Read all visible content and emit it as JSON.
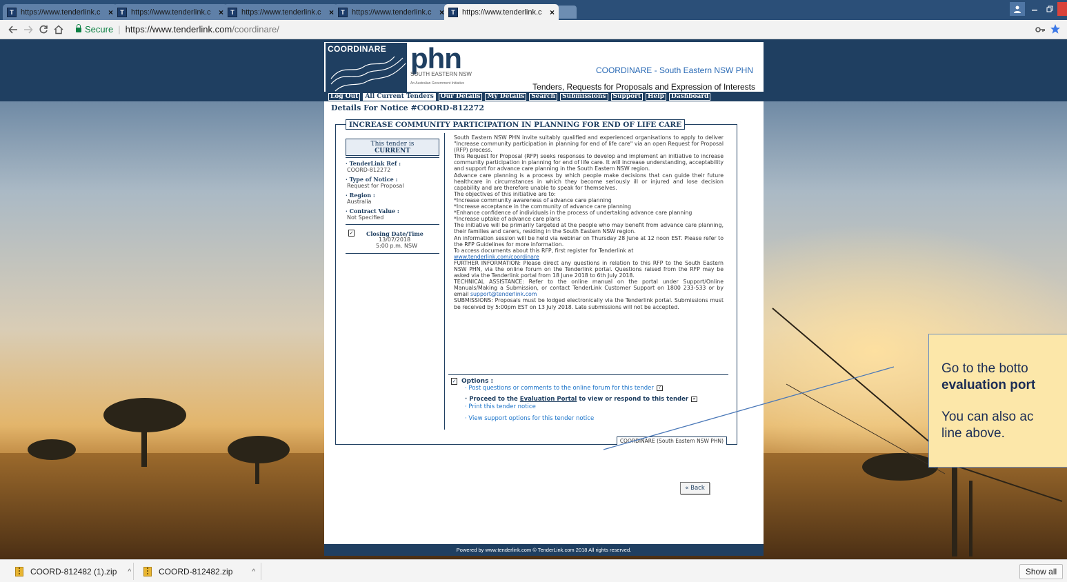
{
  "browser": {
    "tabs": [
      {
        "title": "https://www.tenderlink.c",
        "active": false
      },
      {
        "title": "https://www.tenderlink.c",
        "active": false
      },
      {
        "title": "https://www.tenderlink.c",
        "active": false
      },
      {
        "title": "https://www.tenderlink.c",
        "active": false
      },
      {
        "title": "https://www.tenderlink.c",
        "active": true
      }
    ],
    "favicon_text": "T",
    "tab_close": "×",
    "secure_label": "Secure",
    "url_main": "https://www.tenderlink.com",
    "url_path": "/coordinare/",
    "icons": [
      "back-arrow-icon",
      "forward-arrow-icon",
      "reload-icon",
      "home-icon",
      "lock-icon",
      "key-icon",
      "bookmark-star-icon"
    ],
    "accent": "#2b4f78"
  },
  "header": {
    "logo_word": "COORDINARE",
    "phn": "phn",
    "phn_sub": "SOUTH EASTERN NSW",
    "phn_gov": "An Australian Government Initiative",
    "org_title": "COORDINARE - South Eastern NSW PHN",
    "tagline": "Tenders, Requests for Proposals and Expression of Interests"
  },
  "menu": {
    "items": [
      "Log Out",
      "All Current Tenders",
      "Our Details",
      "My Details",
      "Search",
      "Submissions",
      "Support",
      "Help",
      "Dashboard"
    ],
    "active_index": 1
  },
  "notice": {
    "heading": "Details For Notice #COORD-812272",
    "title": "INCREASE COMMUNITY PARTICIPATION IN PLANNING FOR END OF LIFE CARE",
    "status_line": "This tender is",
    "status": "CURRENT",
    "ref_label": "· TenderLink Ref :",
    "ref_value": "COORD-812272",
    "type_label": "· Type of Notice :",
    "type_value": "Request for Proposal",
    "region_label": "· Region :",
    "region_value": "Australia",
    "contract_label": "· Contract Value :",
    "contract_value": "Not Specified",
    "closing_label": "Closing Date/Time",
    "closing_date": "13/07/2018",
    "closing_time": "5:00 p.m. NSW",
    "paragraphs": [
      "South Eastern NSW PHN invite suitably qualified and experienced organisations to apply to deliver \"Increase community participation in planning for end of life care\" via an open Request for Proposal (RFP) process.",
      "This Request for Proposal (RFP) seeks responses to develop and implement an initiative to increase community participation in planning for end of life care. It will increase understanding, acceptability and support for advance care planning in the South Eastern NSW region.",
      "Advance care planning is a process by which people make decisions that can guide their future healthcare in circumstances in which they become seriously ill or injured and lose decision capability and are therefore unable to speak for themselves.",
      "The objectives of this initiative are to:",
      "*Increase community awareness of advance care planning",
      "*Increase acceptance in the community of advance care planning",
      "*Enhance confidence of individuals in the process of undertaking advance care planning",
      "*Increase uptake of advance care plans",
      "The initiative will be primarily targeted at the people who may benefit from advance care planning, their families and carers, residing in the South Eastern NSW region.",
      "An information session will be held via webinar on Thursday 28 June at 12 noon EST. Please refer to the RFP Guidelines for more information.",
      "To access documents about this RFP, first register for Tenderlink at"
    ],
    "register_link": "www.tenderlink.com/coordinare",
    "further_info": "FURTHER INFORMATION: Please direct any questions in relation to this RFP to the South Eastern NSW PHN, via the online forum on the Tenderlink portal. Questions raised from the RFP may be asked via the Tenderlink portal from 18 June 2018 to 6th July 2018.",
    "tech_prefix": "TECHNICAL ASSISTANCE: Refer to the online manual on the portal under Support/Online Manuals/Making a Submission, or contact TenderLink Customer Support on 1800 233-533 or by email",
    "support_email": "support@tenderlink.com",
    "submissions": "SUBMISSIONS: Proposals must be lodged electronically via the Tenderlink portal. Submissions must be received by 5:00pm EST on 13 July 2018. Late submissions will not be accepted.",
    "options_label": "Options :",
    "opt_forum": "· Post questions or comments to the online forum for this tender",
    "opt_eval_prefix": "· Proceed to the ",
    "opt_eval_link": "Evaluation Portal",
    "opt_eval_suffix": " to view or respond to this tender",
    "opt_print": "· Print this tender notice",
    "opt_support": "· View support options for this tender notice",
    "org_box": "COORDINARE (South Eastern NSW PHN)",
    "back_label": "« Back"
  },
  "footer": {
    "text": "Powered by www.tenderlink.com     © TenderLink.com 2018 All rights reserved."
  },
  "callout": {
    "line1": "Go to the botto",
    "line2": "evaluation port",
    "line3": "You can also ac",
    "line4": "line above.",
    "bg": "#fce7a9"
  },
  "downloads": {
    "items": [
      "COORD-812482 (1).zip",
      "COORD-812482.zip"
    ],
    "caret": "^",
    "show_all": "Show all"
  }
}
